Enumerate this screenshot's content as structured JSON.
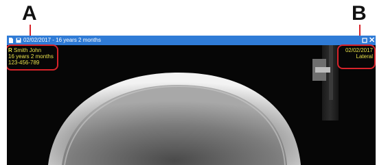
{
  "callouts": {
    "a": "A",
    "b": "B"
  },
  "window": {
    "title": "02/02/2017 - 16 years 2 months",
    "icons": [
      "document-icon",
      "save-icon",
      "maximize-icon",
      "close-icon"
    ],
    "accent_color": "#2f7bd6"
  },
  "overlay": {
    "left": {
      "side_marker": "R",
      "name": "Smith John",
      "age": "16 years 2 months",
      "id": "123-456-789"
    },
    "right": {
      "date": "02/02/2017",
      "view": "Lateral"
    },
    "text_color": "#e8e04a"
  },
  "highlight_color": "#d8232a"
}
